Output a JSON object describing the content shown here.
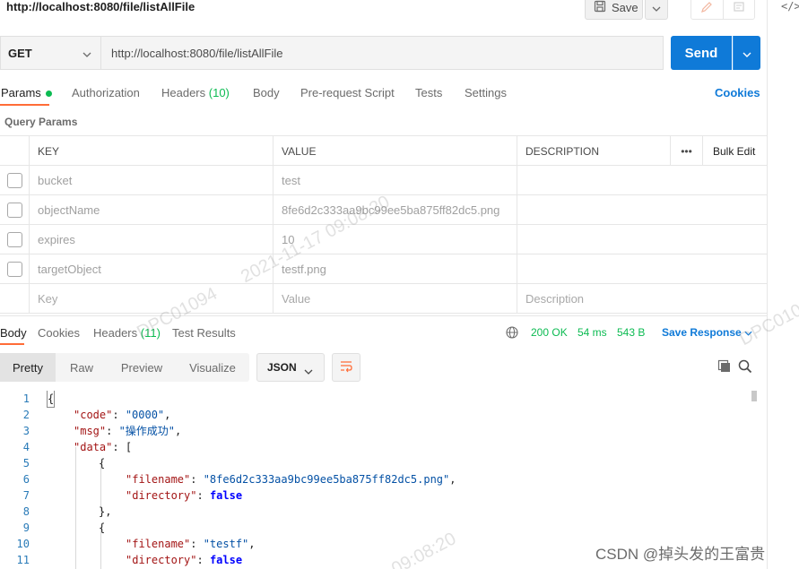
{
  "window": {
    "title_url": "http://localhost:8080/file/listAllFile",
    "save_label": "Save",
    "code_icon": "</>"
  },
  "request": {
    "method": "GET",
    "url": "http://localhost:8080/file/listAllFile",
    "send_label": "Send"
  },
  "req_tabs": {
    "params": "Params",
    "authorization": "Authorization",
    "headers": "Headers",
    "headers_count": "(10)",
    "body": "Body",
    "prerequest": "Pre-request Script",
    "tests": "Tests",
    "settings": "Settings",
    "cookies": "Cookies"
  },
  "query_params": {
    "label": "Query Params",
    "headers": {
      "key": "KEY",
      "value": "VALUE",
      "description": "DESCRIPTION",
      "more": "•••",
      "bulk_edit": "Bulk Edit"
    },
    "rows": [
      {
        "key": "bucket",
        "value": "test"
      },
      {
        "key": "objectName",
        "value": "8fe6d2c333aa9bc99ee5ba875ff82dc5.png"
      },
      {
        "key": "expires",
        "value": "10"
      },
      {
        "key": "targetObject",
        "value": "testf.png"
      }
    ],
    "placeholders": {
      "key": "Key",
      "value": "Value",
      "description": "Description"
    }
  },
  "response": {
    "tabs": {
      "body": "Body",
      "cookies": "Cookies",
      "headers": "Headers",
      "headers_count": "(11)",
      "test_results": "Test Results"
    },
    "status": "200 OK",
    "time": "54 ms",
    "size": "543 B",
    "save_response": "Save Response",
    "views": {
      "pretty": "Pretty",
      "raw": "Raw",
      "preview": "Preview",
      "visualize": "Visualize"
    },
    "format": "JSON"
  },
  "code_lines": [
    {
      "n": "1"
    },
    {
      "n": "2"
    },
    {
      "n": "3"
    },
    {
      "n": "4"
    },
    {
      "n": "5"
    },
    {
      "n": "6"
    },
    {
      "n": "7"
    },
    {
      "n": "8"
    },
    {
      "n": "9"
    },
    {
      "n": "10"
    },
    {
      "n": "11"
    }
  ],
  "code": {
    "open_brace": "{",
    "code_key": "\"code\"",
    "code_val": "\"0000\"",
    "msg_key": "\"msg\"",
    "msg_val": "\"操作成功\"",
    "data_key": "\"data\"",
    "open_bracket": "[",
    "obj_open": "{",
    "filename_key": "\"filename\"",
    "filename_val1": "\"8fe6d2c333aa9bc99ee5ba875ff82dc5.png\"",
    "directory_key": "\"directory\"",
    "false_val": "false",
    "obj_close": "},",
    "filename_val2": "\"testf\""
  },
  "watermarks": {
    "timestamp1": "2021-11-17  09:08:20",
    "user_left": "DPC01094",
    "user_right": "DPC010",
    "timestamp2": "09:08:20"
  },
  "footer": {
    "csdn": "CSDN @掉头发的王富贵"
  }
}
